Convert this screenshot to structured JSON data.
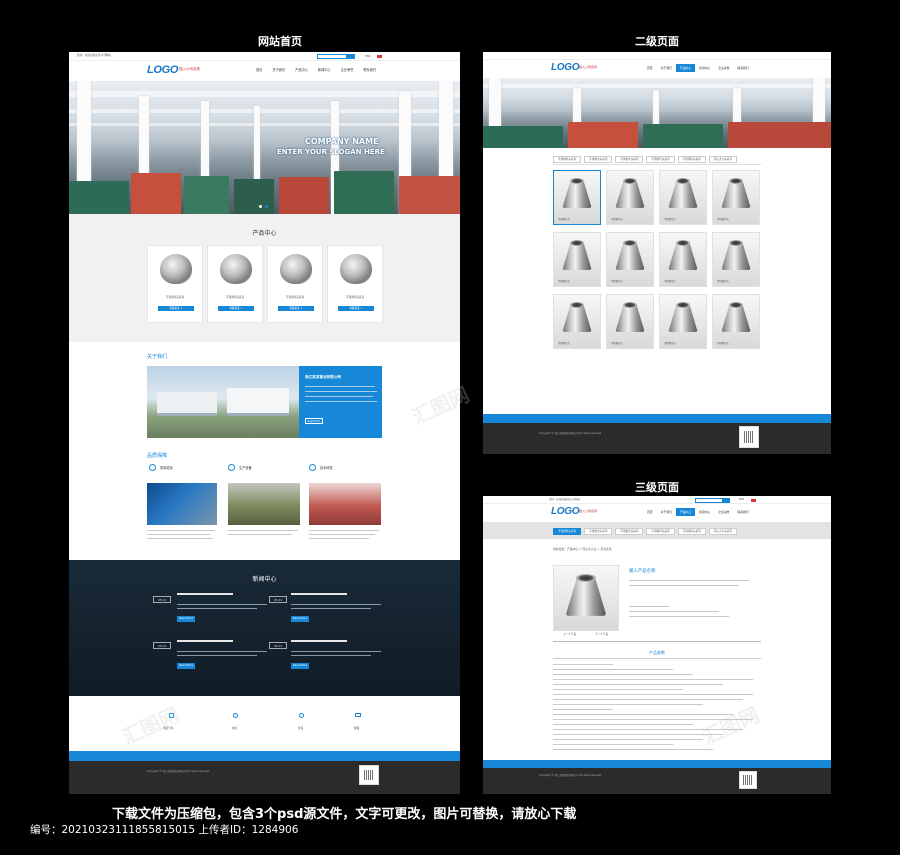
{
  "captions": {
    "home": "网站首页",
    "second": "二级页面",
    "third": "三级页面"
  },
  "header": {
    "logo": "LOGO",
    "logo_sub": "插入公司名称",
    "topbar_left": "您好！欢迎光临某某公司网站",
    "lang": "ENG",
    "nav": [
      "首页",
      "关于我们",
      "产品中心",
      "新闻中心",
      "企业荣誉",
      "联系我们"
    ]
  },
  "home": {
    "banner_line1": "COMPANY NAME",
    "banner_line2": "ENTER YOUR SLOGAN HERE",
    "products_title": "产品中心",
    "products": [
      {
        "name": "不锈钢弯头系列",
        "btn": "查看更多 +"
      },
      {
        "name": "不锈钢弯头系列",
        "btn": "查看更多 +"
      },
      {
        "name": "不锈钢弯头系列",
        "btn": "查看更多 +"
      },
      {
        "name": "不锈钢弯头系列",
        "btn": "查看更多 +"
      }
    ],
    "about_title": "关于我们",
    "about_company": "浙江某某管业有限公司",
    "about_btn": "Read More",
    "quality_title": "品质保障",
    "quality": [
      {
        "label": "质量检测"
      },
      {
        "label": "生产设备"
      },
      {
        "label": "技术研发"
      }
    ],
    "news_title": "新闻中心",
    "news_dates": [
      "05.24",
      "05.24",
      "05.24",
      "05.24"
    ],
    "news_btn": "Read More",
    "contacts": [
      "电话号码",
      "地址",
      "传真",
      "邮箱"
    ],
    "copyright": "Copyright © 浙江某某管业有限公司 All rights reserved"
  },
  "second": {
    "tabs": [
      "不锈钢弯头系列",
      "不锈钢弯头系列",
      "不锈钢弯头系列",
      "不锈钢弯头系列",
      "不锈钢弯头系列",
      "同心大小头系列"
    ],
    "item_label": "不锈钢弯头"
  },
  "third": {
    "breadcrumb": "您的位置：产品中心 > 同心大小头 > 某某某某",
    "product_name": "输入产品名称",
    "params_title": "产品参数",
    "prev": "上一个产品",
    "next": "下一个产品"
  },
  "bottom": {
    "headline": "下载文件为压缩包，包含3个psd源文件，文字可更改，图片可替换，请放心下载",
    "meta": "编号：20210323111855815015 上传者ID：1284906"
  },
  "colors": {
    "accent": "#1788d8",
    "dark_footer": "#2b2b2b",
    "brand_red": "#c0303a"
  }
}
